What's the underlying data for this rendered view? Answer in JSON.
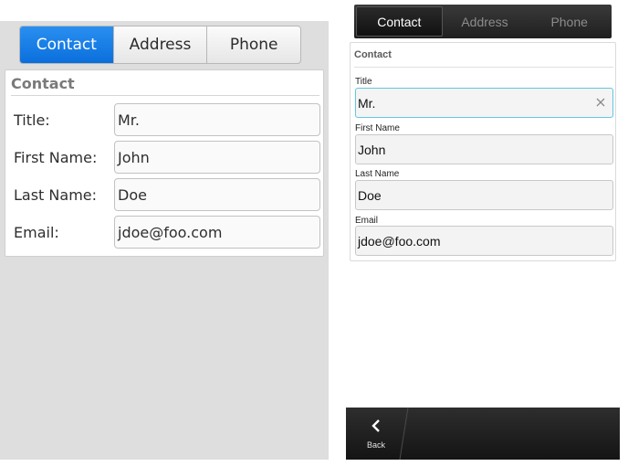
{
  "left": {
    "tabs": [
      {
        "label": "Contact",
        "active": true
      },
      {
        "label": "Address",
        "active": false
      },
      {
        "label": "Phone",
        "active": false
      }
    ],
    "section_title": "Contact",
    "fields": [
      {
        "label": "Title:",
        "value": "Mr."
      },
      {
        "label": "First Name:",
        "value": "John"
      },
      {
        "label": "Last Name:",
        "value": "Doe"
      },
      {
        "label": "Email:",
        "value": "jdoe@foo.com"
      }
    ]
  },
  "right": {
    "tabs": [
      {
        "label": "Contact",
        "active": true
      },
      {
        "label": "Address",
        "active": false
      },
      {
        "label": "Phone",
        "active": false
      }
    ],
    "section_title": "Contact",
    "fields": [
      {
        "label": "Title",
        "value": "Mr.",
        "focused": true
      },
      {
        "label": "First Name",
        "value": "John",
        "focused": false
      },
      {
        "label": "Last Name",
        "value": "Doe",
        "focused": false
      },
      {
        "label": "Email",
        "value": "jdoe@foo.com",
        "focused": false
      }
    ],
    "clear_icon": "close-icon",
    "actionbar": {
      "back_label": "Back",
      "back_icon": "chevron-left-icon"
    }
  },
  "colors": {
    "left_active_tab": "#0a6fdc",
    "left_background": "#dedede",
    "right_focus_border": "#62c7e0",
    "right_bar": "#1f1f1f"
  }
}
